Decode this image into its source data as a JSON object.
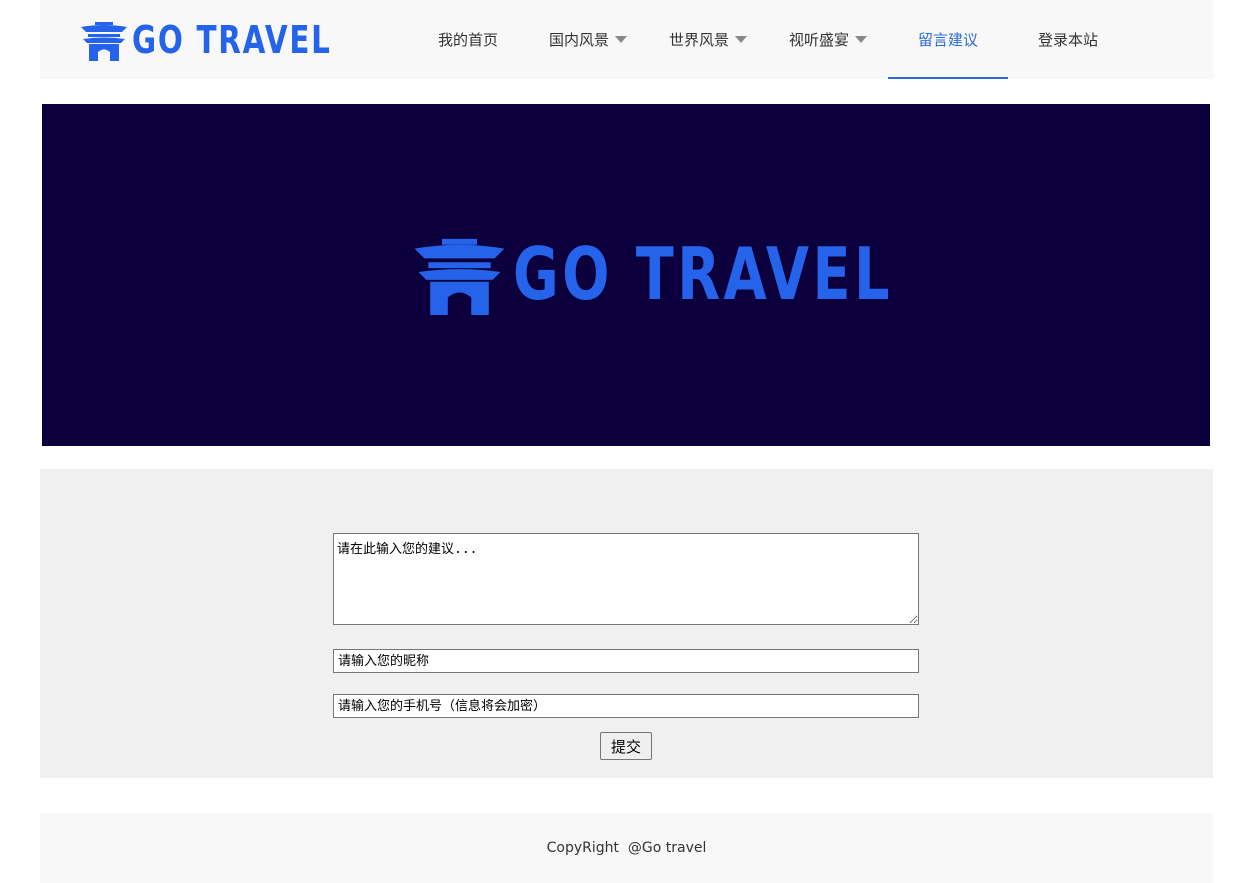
{
  "brand": {
    "logo_text": "GO TRAVEL",
    "logo_icon": "pagoda-gate-icon",
    "brand_color": "#2563eb",
    "accent_color": "#2f6bd8",
    "banner_bg": "#0b003d"
  },
  "nav": {
    "items": [
      {
        "label": "我的首页",
        "dropdown": false,
        "active": false
      },
      {
        "label": "国内风景",
        "dropdown": true,
        "active": false
      },
      {
        "label": "世界风景",
        "dropdown": true,
        "active": false
      },
      {
        "label": "视听盛宴",
        "dropdown": true,
        "active": false
      },
      {
        "label": "留言建议",
        "dropdown": false,
        "active": true
      },
      {
        "label": "登录本站",
        "dropdown": false,
        "active": false
      }
    ]
  },
  "form": {
    "suggestion_placeholder": "请在此输入您的建议...",
    "nickname_placeholder": "请输入您的昵称",
    "phone_placeholder": "请输入您的手机号（信息将会加密）",
    "submit_label": "提交"
  },
  "footer": {
    "copyright": "CopyRight  @Go travel"
  }
}
